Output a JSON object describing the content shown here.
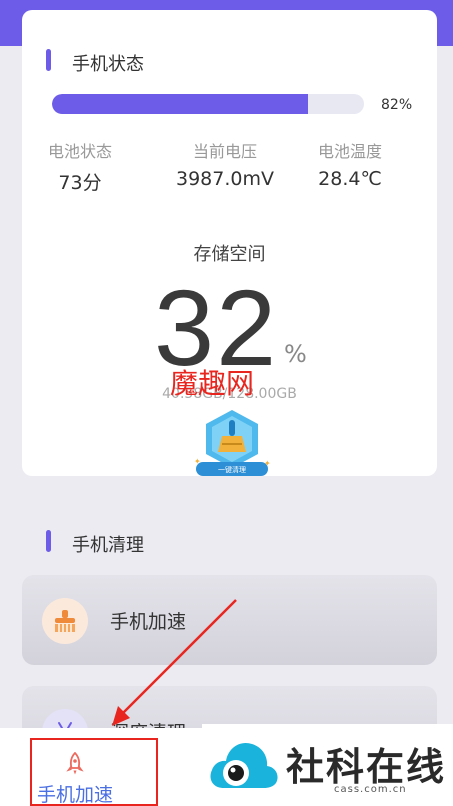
{
  "phone_status": {
    "title": "手机状态",
    "progress": 0.82,
    "progress_text": "82%",
    "stats": [
      {
        "label": "电池状态",
        "value": "73分"
      },
      {
        "label": "当前电压",
        "value": "3987.0mV"
      },
      {
        "label": "电池温度",
        "value": "28.4℃"
      }
    ]
  },
  "storage": {
    "title": "存储空间",
    "percent": "32",
    "percent_sign": "%",
    "detail": "40.58GB/128.00GB",
    "button_label": "一键清理"
  },
  "watermark": "魔趣网",
  "phone_clean": {
    "title": "手机清理",
    "items": [
      {
        "label": "手机加速",
        "icon": "broom-icon"
      },
      {
        "label": "深度清理",
        "icon": "robot-icon"
      }
    ]
  },
  "bottom_nav": {
    "items": [
      {
        "label": "手机加速",
        "icon": "rocket-icon"
      }
    ]
  },
  "logo": {
    "title": "社科在线",
    "url": "cass.com.cn"
  },
  "colors": {
    "accent": "#6c5ce7",
    "highlight": "#e8261f",
    "nav_text": "#4a6fe3"
  }
}
